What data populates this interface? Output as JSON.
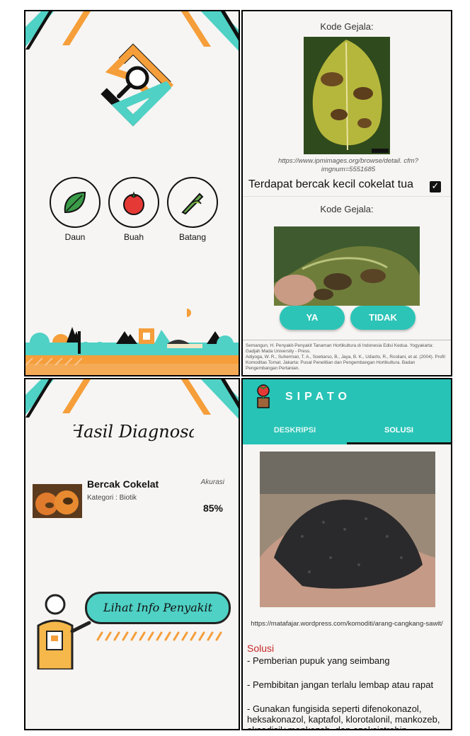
{
  "home": {
    "menu": [
      {
        "label": "Daun",
        "icon": "leaf-icon"
      },
      {
        "label": "Buah",
        "icon": "tomato-icon"
      },
      {
        "label": "Batang",
        "icon": "stem-icon"
      }
    ],
    "colors": {
      "teal": "#4fd1c5",
      "orange": "#f59e3a",
      "black": "#111111"
    }
  },
  "gejala": {
    "kode_label_1": "Kode Gejala:",
    "image_caption": "https://www.ipmimages.org/browse/detail. cfm?imgnum=5551685",
    "symptom_text": "Terdapat bercak kecil cokelat tua",
    "symptom_checked": true,
    "kode_label_2": "Kode Gejala:",
    "btn_yes": "YA",
    "btn_no": "TIDAK",
    "references": [
      "Semangun, H. Penyakit-Penyakit Tanaman Hortikultura di Indonesia Edisi Kedua. Yogyakarta: Gadjah Mada University - Press.",
      "Adiyoga, W. R., Suherman, T. A., Soetiarso, B., Jaya, B. K., Udiarto, R., Rosliani, et al. (2004). Profil Komoditas Tomat. Jakarta: Pusat Penelitian dan Pengembangan Hortikultura. Badan Pengembangan Pertanian."
    ]
  },
  "hasil": {
    "title": "Hasil Diagnosa",
    "result_name": "Bercak Cokelat",
    "result_category": "Kategori : Biotik",
    "accuracy_label": "Akurasi",
    "accuracy_value": "85%",
    "info_button": "Lihat Info Penyakit"
  },
  "solusi": {
    "app_title": "SIPATO",
    "tabs": [
      {
        "label": "DESKRIPSI",
        "active": false
      },
      {
        "label": "SOLUSI",
        "active": true
      }
    ],
    "image_caption": "https://matafajar.wordpress.com/komoditi/arang-cangkang-sawit/",
    "heading": "Solusi",
    "items": [
      "- Pemberian pupuk yang seimbang",
      "- Pembibitan jangan terlalu lembap atau rapat",
      "- Gunakan fungisida seperti difenokonazol, heksakonazol, kaptafol, klorotalonil, mankozeb, oksadisil+mankozeb, dan azoksistrobin"
    ],
    "colors": {
      "appbar": "#27c3b6",
      "heading": "#c62828"
    }
  }
}
